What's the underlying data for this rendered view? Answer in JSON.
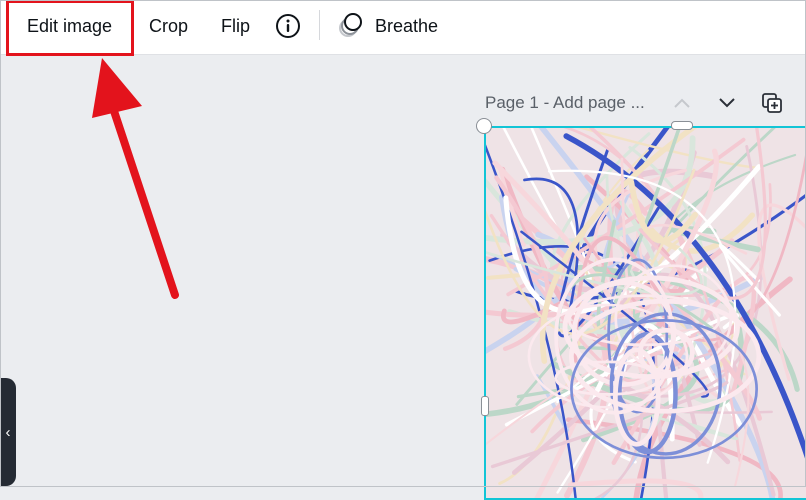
{
  "toolbar": {
    "edit_image_label": "Edit image",
    "crop_label": "Crop",
    "flip_label": "Flip",
    "info_icon": "info-icon",
    "breathe_icon": "breathe-effect-icon",
    "breathe_label": "Breathe"
  },
  "page": {
    "title": "Page 1 - Add page ...",
    "move_up_icon": "chevron-up-icon",
    "move_down_icon": "chevron-down-icon",
    "duplicate_icon": "duplicate-page-icon"
  },
  "canvas": {
    "selection_color": "#12c5d6",
    "image_description_icon": "tangled-lines-image"
  },
  "side_panel": {
    "toggle_glyph": "‹"
  },
  "annotation": {
    "color": "#e3131c"
  }
}
